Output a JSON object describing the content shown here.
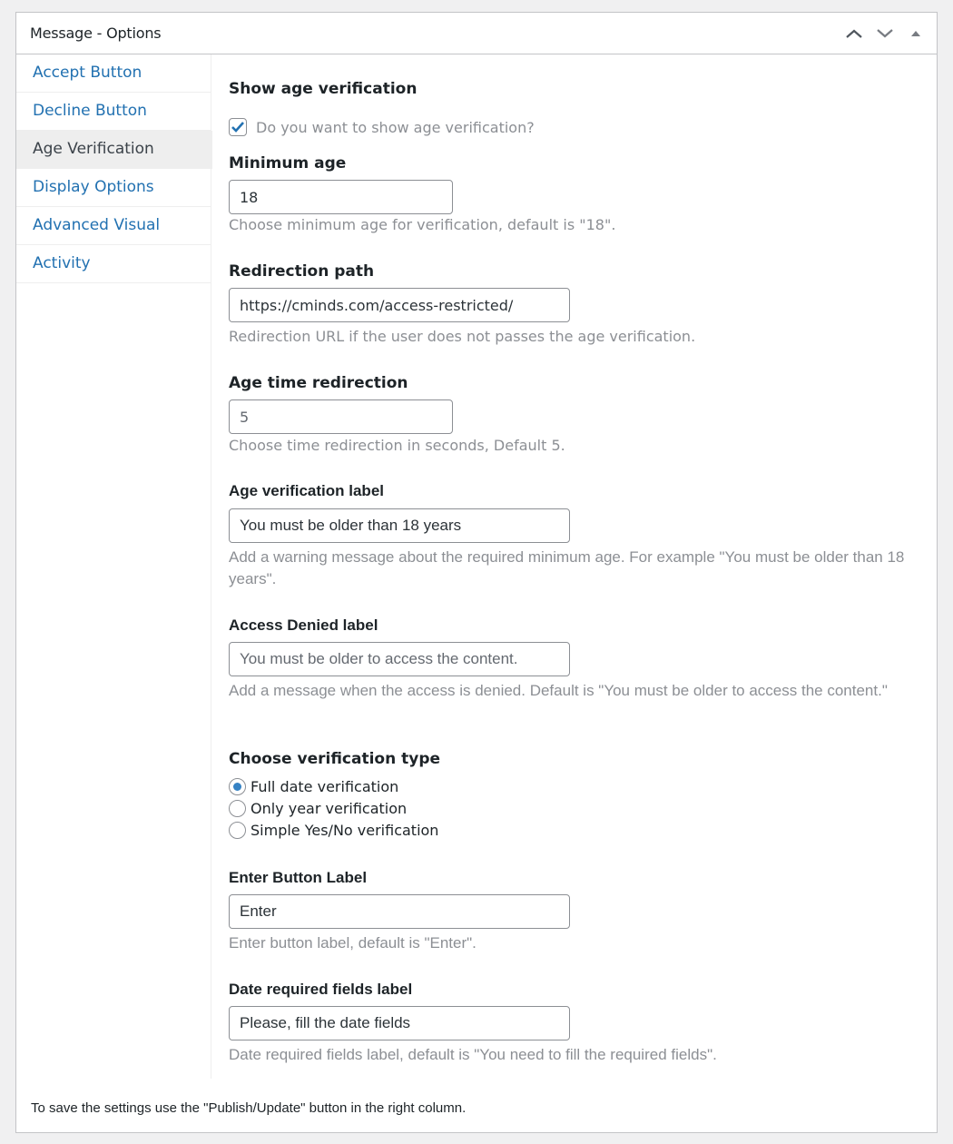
{
  "panel": {
    "title": "Message - Options",
    "controls": {
      "move_up": "move-up",
      "move_down": "move-down",
      "toggle": "toggle-panel"
    }
  },
  "tabs": [
    {
      "label": "Accept Button",
      "active": false
    },
    {
      "label": "Decline Button",
      "active": false
    },
    {
      "label": "Age Verification",
      "active": true
    },
    {
      "label": "Display Options",
      "active": false
    },
    {
      "label": "Advanced Visual",
      "active": false
    },
    {
      "label": "Activity",
      "active": false
    }
  ],
  "fields": {
    "show_age": {
      "label": "Show age verification",
      "checkbox_label": "Do you want to show age verification?",
      "checked": true
    },
    "min_age": {
      "label": "Minimum age",
      "value": "18",
      "description": "Choose minimum age for verification, default is \"18\"."
    },
    "redirection_path": {
      "label": "Redirection path",
      "value": "https://cminds.com/access-restricted/",
      "description": "Redirection URL if the user does not passes the age verification."
    },
    "age_time_redirection": {
      "label": "Age time redirection",
      "value": "",
      "placeholder": "5",
      "description": "Choose time redirection in seconds, Default 5."
    },
    "age_verification_label": {
      "label": "Age verification label",
      "value": "You must be older than 18 years",
      "description": "Add a warning message about the required minimum age. For example \"You must be older than 18 years\"."
    },
    "access_denied_label": {
      "label": "Access Denied label",
      "value": "",
      "placeholder": "You must be older to access the content.",
      "description": "Add a message when the access is denied. Default is \"You must be older to access the content.\""
    },
    "verification_type": {
      "label": "Choose verification type",
      "options": [
        {
          "label": "Full date verification",
          "selected": true
        },
        {
          "label": "Only year verification",
          "selected": false
        },
        {
          "label": "Simple Yes/No verification",
          "selected": false
        }
      ]
    },
    "enter_button_label": {
      "label": "Enter Button Label",
      "value": "Enter",
      "description": "Enter button label, default is \"Enter\"."
    },
    "date_required_label": {
      "label": "Date required fields label",
      "value": "Please, fill the date fields",
      "description": "Date required fields label, default is \"You need to fill the required fields\"."
    }
  },
  "footer_note": "To save the settings use the \"Publish/Update\" button in the right column.",
  "colors": {
    "link": "#2271b1",
    "accent": "#3582c4",
    "muted": "#8c8f94"
  }
}
